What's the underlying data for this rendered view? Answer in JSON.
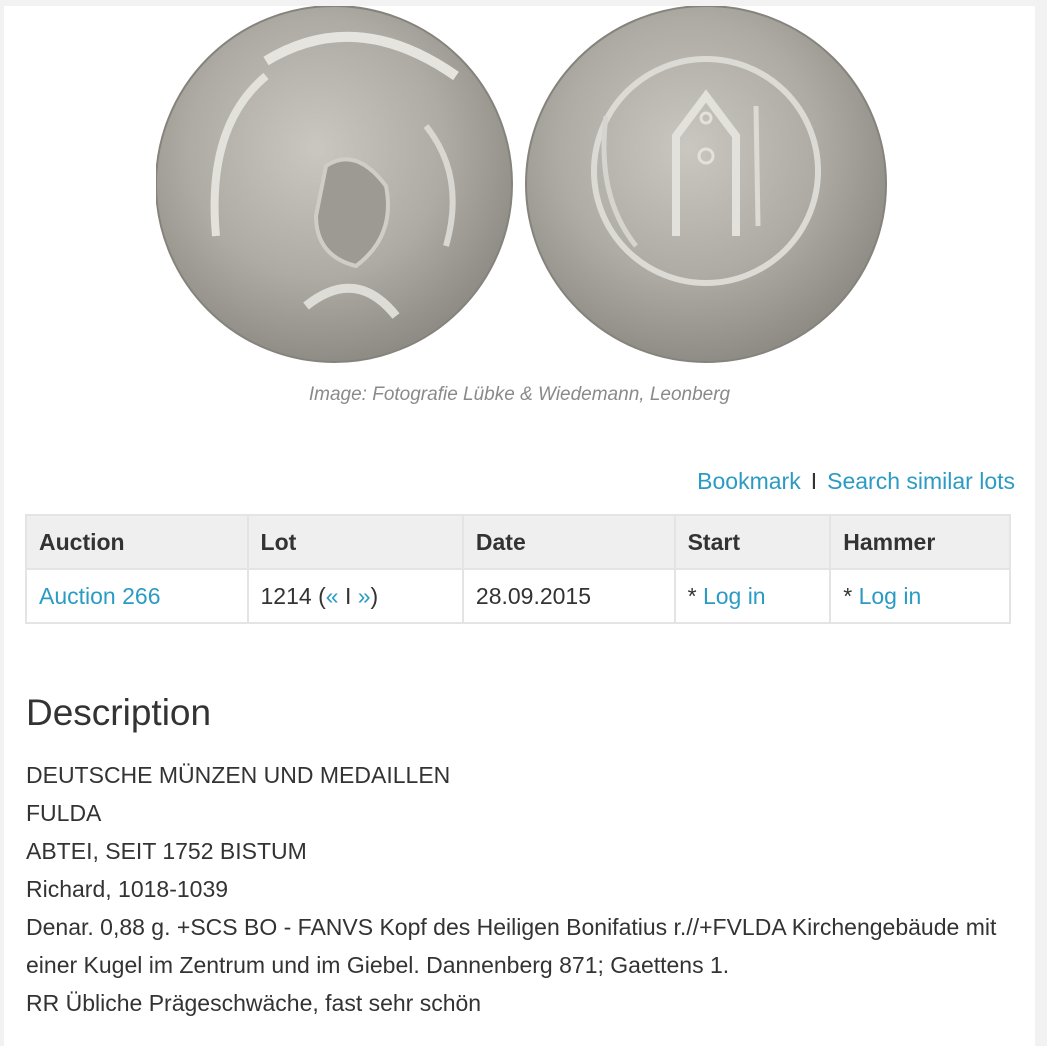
{
  "image_caption": "Image: Fotografie Lübke & Wiedemann, Leonberg",
  "actions": {
    "bookmark": "Bookmark",
    "separator": "I",
    "search_similar": "Search similar lots"
  },
  "table": {
    "headers": [
      "Auction",
      "Lot",
      "Date",
      "Start",
      "Hammer"
    ],
    "row": {
      "auction": "Auction 266",
      "lot_number": "1214",
      "lot_open": "(",
      "prev": "«",
      "nav_sep": "I",
      "next": "»",
      "lot_close": ")",
      "date": "28.09.2015",
      "start_prefix": "* ",
      "start_link": "Log in",
      "hammer_prefix": "* ",
      "hammer_link": "Log in"
    }
  },
  "description": {
    "title": "Description",
    "lines": [
      "DEUTSCHE MÜNZEN UND MEDAILLEN",
      "FULDA",
      "ABTEI, SEIT 1752 BISTUM",
      "Richard, 1018-1039",
      "Denar. 0,88 g. +SCS BO - FANVS Kopf des Heiligen Bonifatius r.//+FVLDA Kirchengebäude mit einer Kugel im Zentrum und im Giebel. Dannenberg 871; Gaettens 1.",
      "RR Übliche Prägeschwäche, fast sehr schön"
    ]
  },
  "colors": {
    "link": "#2b9bc4",
    "text": "#333333",
    "caption": "#8a8a8a",
    "table_header_bg": "#efefef",
    "border": "#e4e4e4"
  }
}
